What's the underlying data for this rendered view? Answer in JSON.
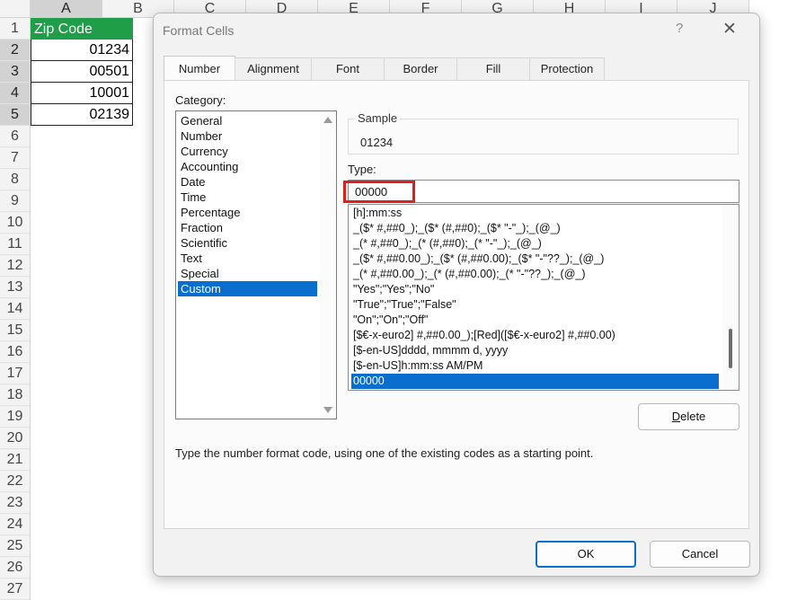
{
  "spreadsheet": {
    "columns": [
      "A",
      "B",
      "C",
      "D",
      "E",
      "F",
      "G",
      "H",
      "I",
      "J"
    ],
    "rows": [
      "1",
      "2",
      "3",
      "4",
      "5",
      "6",
      "7",
      "8",
      "9",
      "10",
      "11",
      "12",
      "13",
      "14",
      "15",
      "16",
      "17",
      "18",
      "19",
      "20",
      "21",
      "22",
      "23",
      "24",
      "25",
      "26",
      "27"
    ],
    "column_a": [
      "Zip Code",
      "01234",
      "00501",
      "10001",
      "02139"
    ],
    "header_fill_color": "#1f9d49"
  },
  "dialog": {
    "title": "Format Cells",
    "help_label": "?",
    "close_label": "✕",
    "tabs": [
      "Number",
      "Alignment",
      "Font",
      "Border",
      "Fill",
      "Protection"
    ],
    "active_tab": "Number",
    "category_label": "Category:",
    "categories": [
      "General",
      "Number",
      "Currency",
      "Accounting",
      "Date",
      "Time",
      "Percentage",
      "Fraction",
      "Scientific",
      "Text",
      "Special",
      "Custom"
    ],
    "selected_category": "Custom",
    "sample_label": "Sample",
    "sample_value": "01234",
    "type_label": "Type:",
    "type_value": "00000",
    "format_codes": [
      "[h]:mm:ss",
      "_($* #,##0_);_($* (#,##0);_($* \"-\"_);_(@_)",
      "_(* #,##0_);_(* (#,##0);_(* \"-\"_);_(@_)",
      "_($* #,##0.00_);_($* (#,##0.00);_($* \"-\"??_);_(@_)",
      "_(* #,##0.00_);_(* (#,##0.00);_(* \"-\"??_);_(@_)",
      "\"Yes\";\"Yes\";\"No\"",
      "\"True\";\"True\";\"False\"",
      "\"On\";\"On\";\"Off\"",
      "[$€-x-euro2] #,##0.00_);[Red]([$€-x-euro2] #,##0.00)",
      "[$-en-US]dddd, mmmm d, yyyy",
      "[$-en-US]h:mm:ss AM/PM",
      "00000"
    ],
    "selected_format": "00000",
    "delete_label_underlined": "D",
    "delete_label_rest": "elete",
    "hint": "Type the number format code, using one of the existing codes as a starting point.",
    "ok_label": "OK",
    "cancel_label": "Cancel",
    "accent_color": "#0a6ece",
    "annotation_color": "#e11d1d"
  }
}
